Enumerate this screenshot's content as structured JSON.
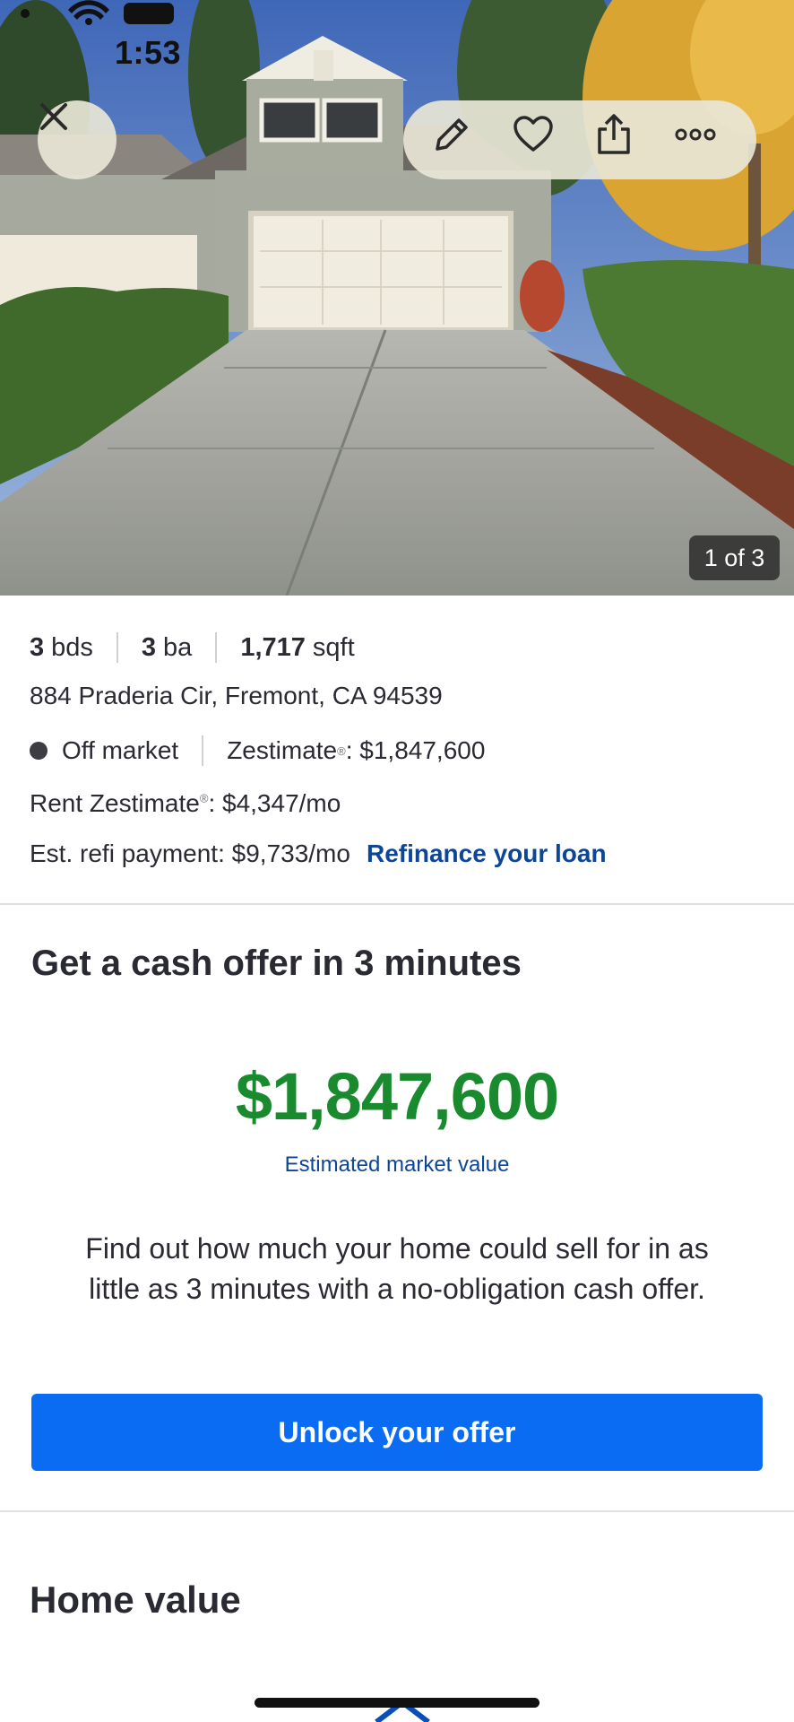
{
  "status_bar": {
    "time": "1:53"
  },
  "hero": {
    "photo_counter": "1 of 3"
  },
  "actions": [
    "edit-icon",
    "heart-icon",
    "share-icon",
    "more-icon"
  ],
  "facts": {
    "beds_value": "3",
    "beds_unit": "bds",
    "baths_value": "3",
    "baths_unit": "ba",
    "sqft_value": "1,717",
    "sqft_unit": "sqft"
  },
  "address": "884 Praderia Cir, Fremont, CA 94539",
  "status": {
    "label": "Off market",
    "zestimate_label": "Zestimate",
    "zestimate_value": ": $1,847,600"
  },
  "rent": {
    "label": "Rent Zestimate",
    "value": ": $4,347/mo"
  },
  "refi": {
    "text": "Est. refi payment: $9,733/mo",
    "link": "Refinance your loan"
  },
  "offer": {
    "title": "Get a cash offer in 3 minutes",
    "value": "$1,847,600",
    "value_caption": "Estimated market value",
    "description": "Find out how much your home could sell for in as little as 3 minutes with a no-obligation cash offer.",
    "button": "Unlock your offer"
  },
  "home_value": {
    "title": "Home value"
  },
  "colors": {
    "accent_blue": "#0a6cf2",
    "link_blue": "#0d4597",
    "value_green": "#1a8a2e"
  }
}
